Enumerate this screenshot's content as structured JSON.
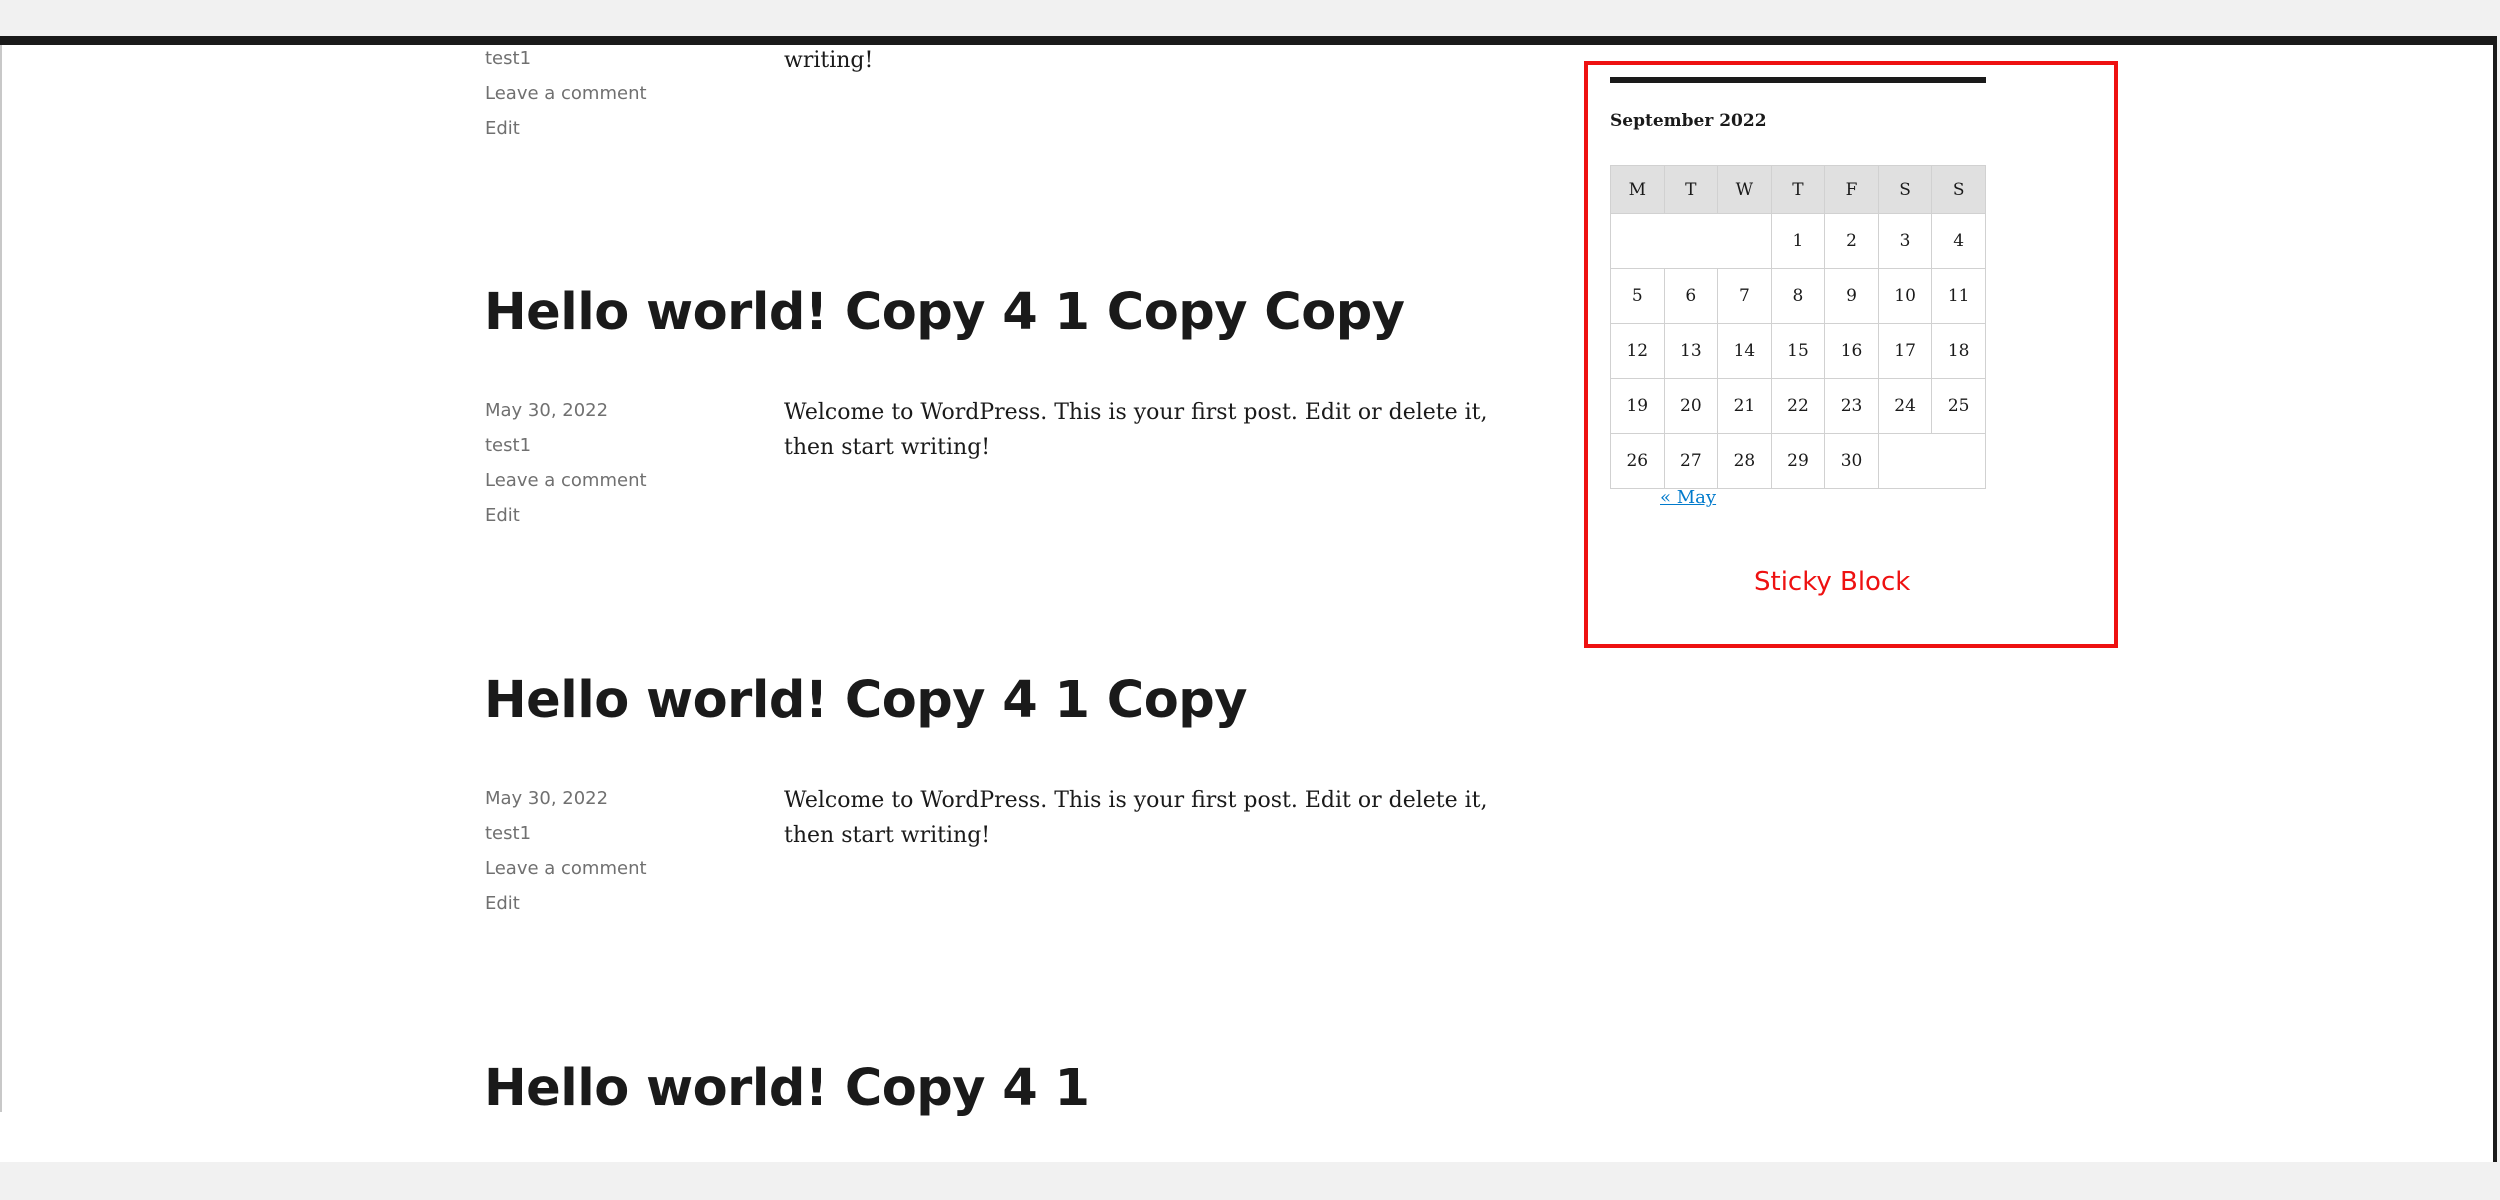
{
  "posts_top": {
    "author": "test1",
    "comment": "Leave a comment",
    "edit": "Edit",
    "excerpt_tail": "writing!"
  },
  "posts": [
    {
      "title": "Hello world! Copy 4 1 Copy Copy",
      "date": "May 30, 2022",
      "author": "test1",
      "comment": "Leave a comment",
      "edit": "Edit",
      "excerpt": "Welcome to WordPress. This is your first post. Edit or delete it, then start writing!"
    },
    {
      "title": "Hello world! Copy 4 1 Copy",
      "date": "May 30, 2022",
      "author": "test1",
      "comment": "Leave a comment",
      "edit": "Edit",
      "excerpt": "Welcome to WordPress. This is your first post. Edit or delete it, then start writing!"
    },
    {
      "title": "Hello world! Copy 4 1"
    }
  ],
  "calendar": {
    "caption": "September 2022",
    "weekdays": [
      "M",
      "T",
      "W",
      "T",
      "F",
      "S",
      "S"
    ],
    "weeks": [
      [
        "",
        "",
        "",
        "1",
        "2",
        "3",
        "4"
      ],
      [
        "5",
        "6",
        "7",
        "8",
        "9",
        "10",
        "11"
      ],
      [
        "12",
        "13",
        "14",
        "15",
        "16",
        "17",
        "18"
      ],
      [
        "19",
        "20",
        "21",
        "22",
        "23",
        "24",
        "25"
      ],
      [
        "26",
        "27",
        "28",
        "29",
        "30",
        "",
        ""
      ]
    ],
    "prev_link": "« May"
  },
  "sticky": {
    "label": "Sticky Block",
    "border_color": "#ee1111"
  }
}
